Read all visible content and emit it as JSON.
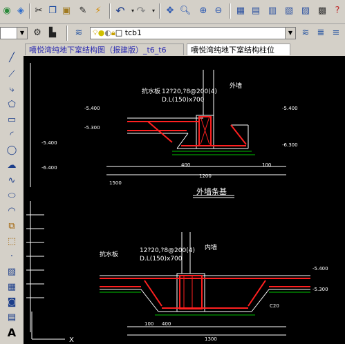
{
  "toolbar2": {
    "layer_name": "tcb1"
  },
  "tabs": [
    {
      "label": "嘻悦湾纯地下室结构图（报建版）_t6_t6"
    },
    {
      "label": "嘻悦湾纯地下室结构柱位"
    }
  ],
  "left_toolbar": {
    "text_tool_label": "A"
  },
  "drawing": {
    "top_detail": {
      "title": "外墙条基",
      "wall_label": "外墙",
      "slab_label": "抗水板",
      "rebar_note_1": "12?20,?8@200(4)",
      "rebar_note_2": "D.L(150)x700",
      "elev_left_1": "-5.400",
      "elev_left_2": "-5.300",
      "elev_left_3": "-5.400",
      "elev_left_4": "-6.400",
      "elev_right_1": "-5.400",
      "elev_right_2": "-6.300",
      "dim_400": "400",
      "dim_1200": "1200",
      "dim_100": "100",
      "dim_1500": "1500"
    },
    "bottom_detail": {
      "wall_label": "内墙",
      "slab_label": "抗水板",
      "rebar_note_1": "12?20,?8@200(4)",
      "rebar_note_2": "D.L(150)x700",
      "elev_right_1": "-5.400",
      "elev_right_2": "-5.300",
      "dim_1300": "1300",
      "dim_400": "400",
      "dim_100": "100",
      "note_c20": "C20"
    },
    "ucs_x": "X"
  }
}
